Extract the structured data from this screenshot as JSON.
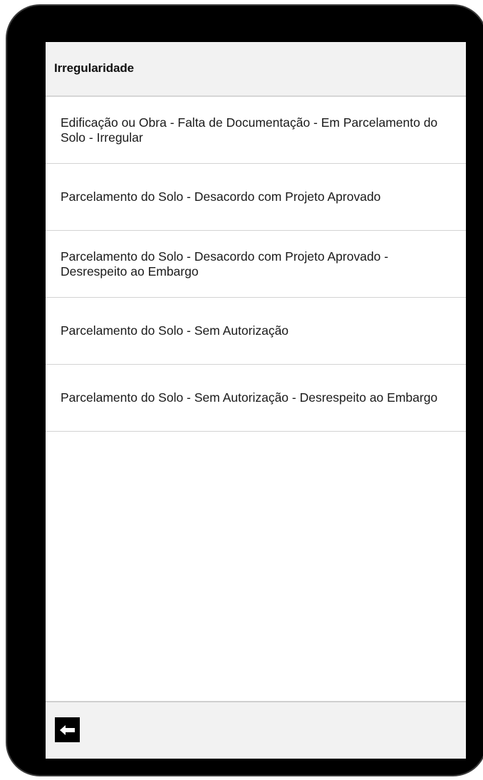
{
  "header": {
    "title": "Irregularidade"
  },
  "list": {
    "items": [
      {
        "label": "Edificação ou Obra - Falta de Documentação - Em Parcelamento do Solo - Irregular"
      },
      {
        "label": "Parcelamento do Solo - Desacordo com Projeto Aprovado"
      },
      {
        "label": "Parcelamento do Solo - Desacordo com Projeto Aprovado - Desrespeito ao Embargo"
      },
      {
        "label": "Parcelamento do Solo - Sem Autorização"
      },
      {
        "label": "Parcelamento do Solo - Sem Autorização - Desrespeito ao Embargo"
      }
    ]
  },
  "footer": {
    "back_icon": "arrow-left-icon"
  },
  "colors": {
    "device_frame": "#000000",
    "header_bg": "#f2f2f2",
    "divider": "#d3d3d3",
    "text": "#1a1a1a",
    "back_button_bg": "#000000"
  }
}
